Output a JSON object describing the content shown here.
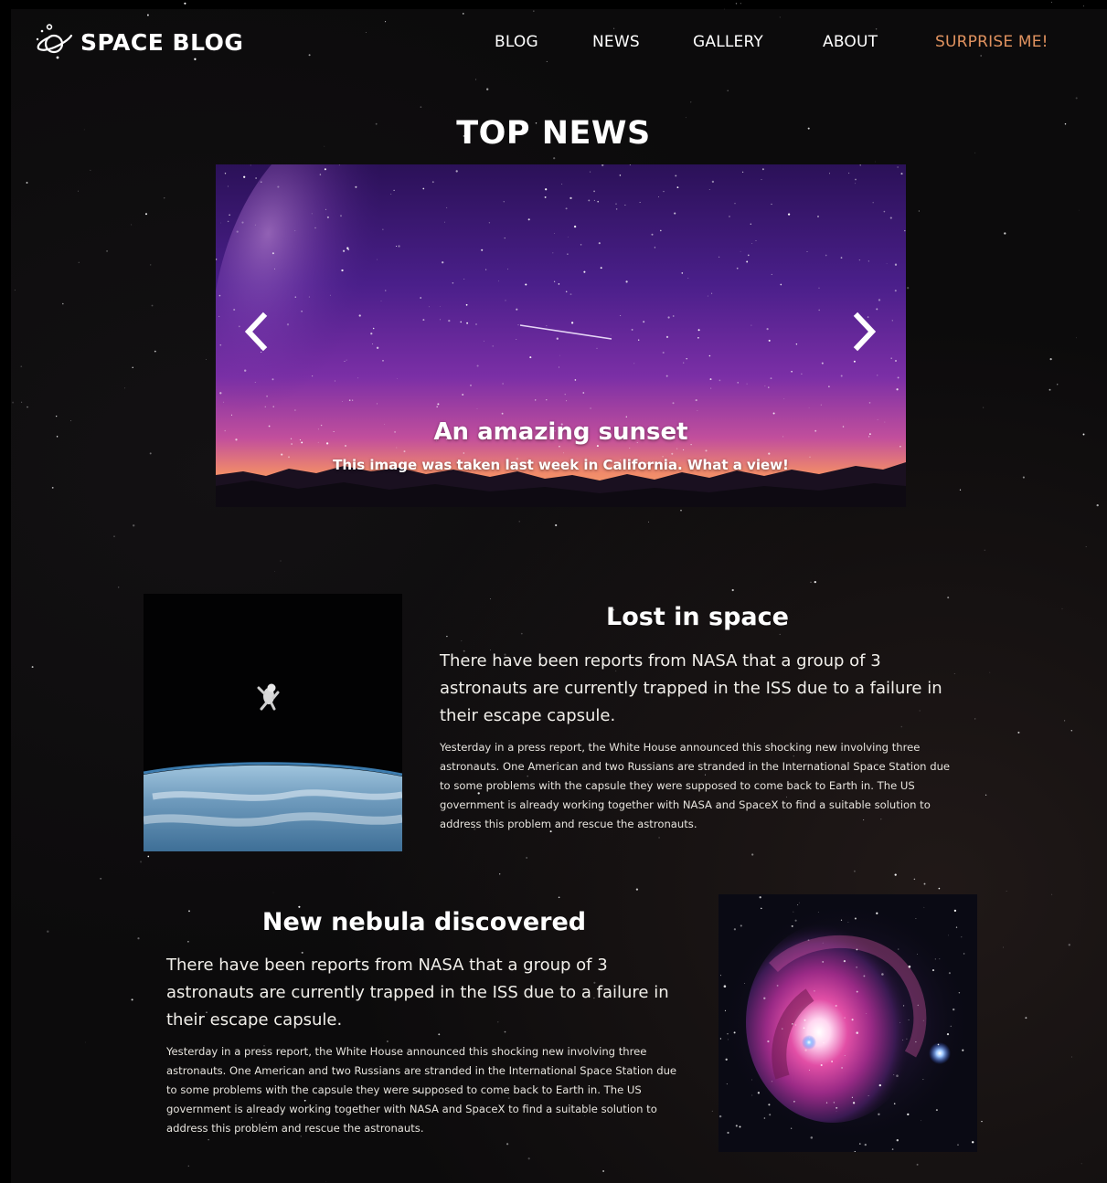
{
  "brand": {
    "name": "SPACE BLOG",
    "icon": "planet-orbit-icon"
  },
  "nav": {
    "items": [
      {
        "label": "BLOG"
      },
      {
        "label": "NEWS"
      },
      {
        "label": "GALLERY"
      },
      {
        "label": "ABOUT"
      },
      {
        "label": "SURPRISE ME!",
        "color": "#e0925f"
      }
    ]
  },
  "top_news": {
    "title": "TOP NEWS",
    "carousel": {
      "prev_icon": "chevron-left-icon",
      "next_icon": "chevron-right-icon",
      "slide": {
        "title": "An amazing sunset",
        "caption": "This image was taken last week in California. What a view!"
      }
    }
  },
  "articles": [
    {
      "title": "Lost in space",
      "lead": "There have been reports from NASA that a group of 3 astronauts are currently trapped in the ISS due to a failure in their escape capsule.",
      "body": "Yesterday in a press report, the White House announced this shocking new involving three astronauts. One American and two Russians are stranded in the International Space Station due to some problems with the capsule they were supposed to come back to Earth in. The US government is already working together with NASA and SpaceX to find a suitable solution to address this problem and rescue the astronauts."
    },
    {
      "title": "New nebula discovered",
      "lead": "There have been reports from NASA that a group of 3 astronauts are currently trapped in the ISS due to a failure in their escape capsule.",
      "body": "Yesterday in a press report, the White House announced this shocking new involving three astronauts. One American and two Russians are stranded in the International Space Station due to some problems with the capsule they were supposed to come back to Earth in. The US government is already working together with NASA and SpaceX to find a suitable solution to address this problem and rescue the astronauts."
    }
  ],
  "colors": {
    "background": "#0c0b0c",
    "text": "#ffffff",
    "accent": "#e0925f"
  }
}
